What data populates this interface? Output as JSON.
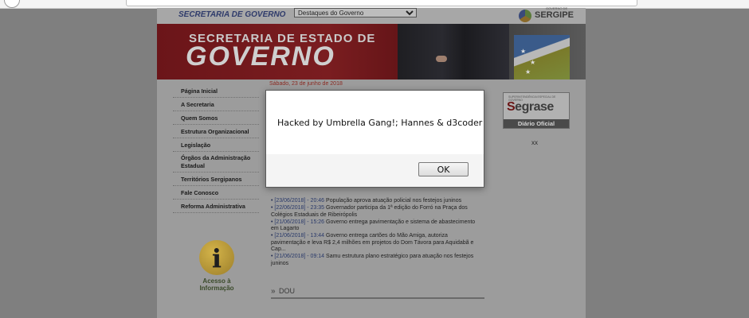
{
  "site": {
    "header_title": "SECRETARIA DE GOVERNO",
    "dropdown_selected": "Destaques do Governo",
    "logo_text": "SERGIPE",
    "logo_small": "GOVERNO DE"
  },
  "banner": {
    "line1": "SECRETARIA DE ESTADO DE",
    "line2": "GOVERNO"
  },
  "menu": {
    "items": [
      {
        "label": "Página Inicial"
      },
      {
        "label": "A Secretaria"
      },
      {
        "label": "Quem Somos"
      },
      {
        "label": "Estrutura Organizacional"
      },
      {
        "label": "Legislação"
      },
      {
        "label": "Órgãos da Administração Estadual"
      },
      {
        "label": "Territórios Sergipanos"
      },
      {
        "label": "Fale Conosco"
      },
      {
        "label": "Reforma Administrativa"
      }
    ]
  },
  "acesso": {
    "symbol": "i",
    "line1": "Acesso à",
    "line2": "Informação"
  },
  "main": {
    "date": "Sábado, 23 de junho de 2018",
    "news": [
      {
        "stamp": "[23/06/2018] - 20:46",
        "text": "População aprova atuação policial nos festejos juninos"
      },
      {
        "stamp": "[22/06/2018] - 23:35",
        "text": "Governador participa da 1ª edição do Forró na Praça dos Colégios Estaduais de Ribeirópolis"
      },
      {
        "stamp": "[21/06/2018] - 15:26",
        "text": "Governo entrega pavimentação e sistema de abastecimento em Lagarto"
      },
      {
        "stamp": "[21/06/2018] - 13:44",
        "text": "Governo entrega cartões do Mão Amiga, autoriza pavimentação e leva R$ 2,4 milhões em projetos do Dom Távora para Aquidabã e Cap..."
      },
      {
        "stamp": "[21/06/2018] - 09:14",
        "text": "Samu estrutura plano estratégico para atuação nos festejos juninos"
      }
    ],
    "dou_label": "DOU"
  },
  "right": {
    "segrase_top": "SUPERINTENDÊNCIA ESPECIAL DE GOVERNO",
    "segrase_first": "S",
    "segrase_rest": "egrase",
    "segrase_sub": "Diário Oficial",
    "xx": "xx"
  },
  "dialog": {
    "message": "Hacked by Umbrella Gang!; Hannes & d3coder",
    "ok_label": "OK"
  }
}
